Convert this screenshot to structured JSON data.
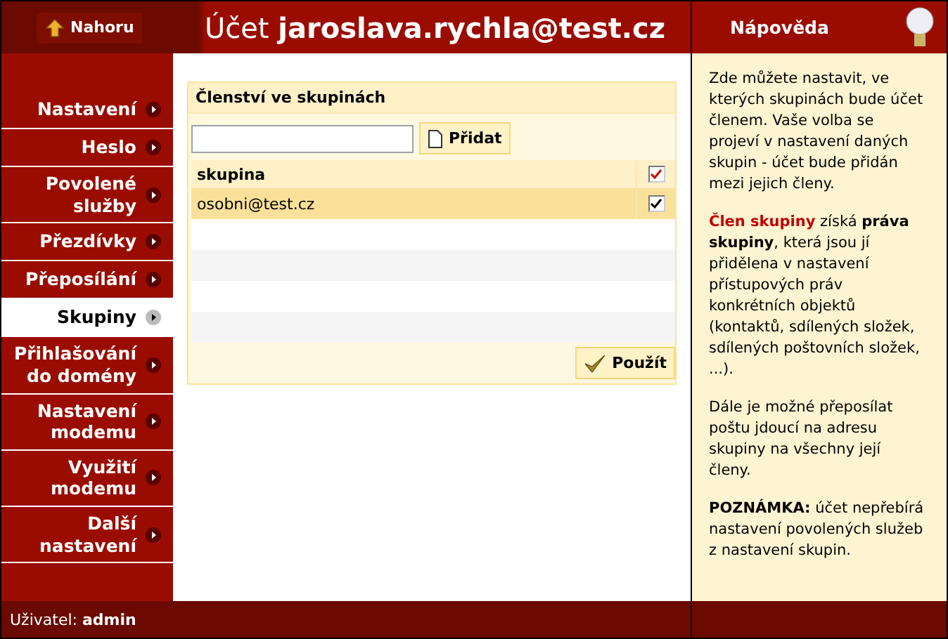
{
  "header": {
    "up_button": "Nahoru",
    "title_prefix": "Účet",
    "title_account": "jaroslava.rychla@test.cz"
  },
  "nav": [
    {
      "label": "Nastavení",
      "selected": false
    },
    {
      "label": "Heslo",
      "selected": false
    },
    {
      "label": "Povolené služby",
      "selected": false
    },
    {
      "label": "Přezdívky",
      "selected": false
    },
    {
      "label": "Přeposílání",
      "selected": false
    },
    {
      "label": "Skupiny",
      "selected": true
    },
    {
      "label": "Přihlašování do domény",
      "selected": false
    },
    {
      "label": "Nastavení modemu",
      "selected": false
    },
    {
      "label": "Využití modemu",
      "selected": false
    },
    {
      "label": "Další nastavení",
      "selected": false
    }
  ],
  "panel": {
    "title": "Členství ve skupinách",
    "add_button": "Přidat",
    "columns": [
      "skupina"
    ],
    "header_checked": true,
    "rows": [
      {
        "group": "osobni@test.cz",
        "checked": true,
        "selected": true
      }
    ],
    "apply_button": "Použít"
  },
  "help": {
    "title": "Nápověda",
    "paragraphs": [
      [
        {
          "kind": "plain",
          "text": "Zde můžete nastavit, ve kterých skupinách bude účet členem. Vaše volba se projeví v nastavení daných skupin - účet bude přidán mezi jejich členy."
        }
      ],
      [
        {
          "kind": "link",
          "text": "Člen skupiny"
        },
        {
          "kind": "plain",
          "text": " získá **práva skupiny**, která jsou jí přidělena v nastavení přístupových práv konkrétních objektů (kontaktů, sdílených složek, sdílených poštovních složek, ...)."
        }
      ],
      [
        {
          "kind": "plain",
          "text": "Dále je možné přeposílat poštu jdoucí na adresu skupiny na všechny její členy."
        }
      ],
      [
        {
          "kind": "plain",
          "text": "**POZNÁMKA:** účet nepřebírá nastavení povolených služeb z nastavení skupin."
        }
      ]
    ]
  },
  "footer": {
    "user_label": "Uživatel:",
    "user_name": "admin"
  }
}
